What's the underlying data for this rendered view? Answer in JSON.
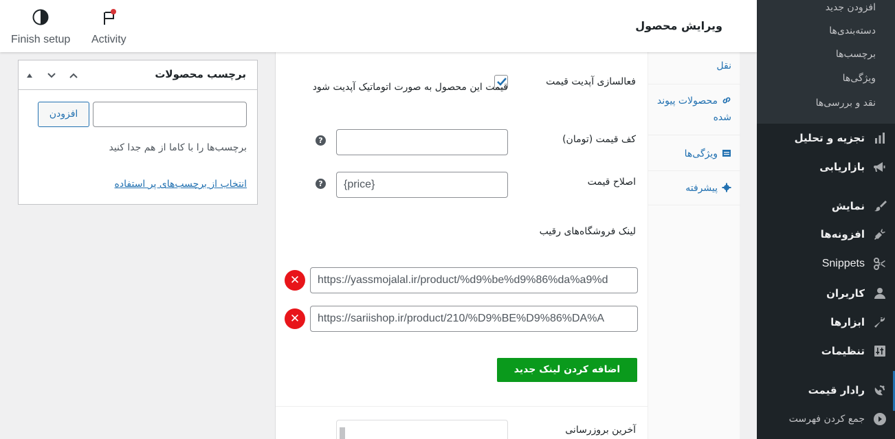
{
  "header": {
    "page_title": "ویرایش محصول",
    "finish_setup_label": "Finish setup",
    "activity_label": "Activity"
  },
  "sidebar": {
    "submenu": [
      "افزودن جدید",
      "دسته‌بندی‌ها",
      "برچسب‌ها",
      "ویژگی‌ها",
      "نقد و بررسی‌ها"
    ],
    "items": [
      {
        "label": "تجزیه و تحلیل",
        "icon": "bar-chart-icon"
      },
      {
        "label": "بازاریابی",
        "icon": "megaphone-icon"
      },
      {
        "label": "نمایش",
        "icon": "brush-icon"
      },
      {
        "label": "افزونه‌ها",
        "icon": "plug-icon"
      },
      {
        "label": "Snippets",
        "icon": "scissors-icon"
      },
      {
        "label": "کاربران",
        "icon": "user-icon"
      },
      {
        "label": "ابزارها",
        "icon": "wrench-icon"
      },
      {
        "label": "تنظیمات",
        "icon": "sliders-icon"
      },
      {
        "label": "رادار قیمت",
        "icon": "radar-icon"
      },
      {
        "label": "جمع کردن فهرست",
        "icon": "collapse-icon"
      }
    ]
  },
  "product_data": {
    "tabs": {
      "shipping_partial": "نقل",
      "linked_products": "محصولات پیوند شده",
      "attributes": "ویژگی‌ها",
      "advanced": "پیشرفته"
    },
    "auto_update": {
      "label": "فعالسازی آپدیت قیمت",
      "checkbox_text": "قیمت این محصول به صورت اتوماتیک آپدیت شود",
      "checked": true
    },
    "min_price": {
      "label": "کف قیمت (تومان)",
      "value": ""
    },
    "price_fix": {
      "label": "اصلاح قیمت",
      "value": "{price}"
    },
    "competitor_links": {
      "label": "لینک فروشگاه‌های رقیب",
      "links": [
        "https://yassmojalal.ir/product/%d9%be%d9%86%da%a9%d",
        "https://sariishop.ir/product/210/%D9%BE%D9%86%DA%A"
      ],
      "add_button": "اضافه کردن لینک جدید"
    },
    "last_update_label": "آخرین بروزرسانی"
  },
  "tags_box": {
    "title": "برچسب محصولات",
    "add_button": "افزودن",
    "hint": "برچسب‌ها را با کاما از هم جدا کنید",
    "choose_link": "انتخاب از برچسب‌های پر استفاده"
  },
  "colors": {
    "sidebar_bg": "#1d2327",
    "submenu_bg": "#2c3338",
    "link_blue": "#2271b1",
    "add_button_green": "#0a9a1c",
    "remove_red": "#e8151a"
  }
}
